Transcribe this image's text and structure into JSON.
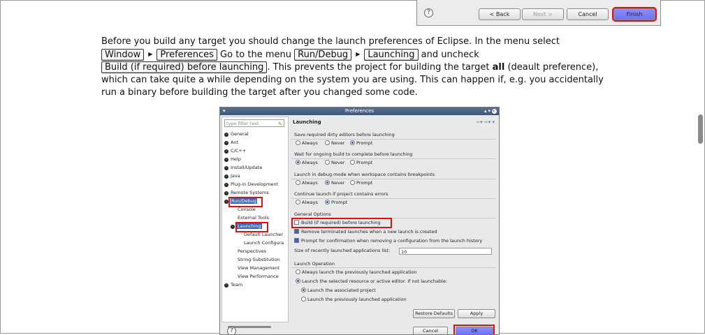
{
  "wizard": {
    "back": "< Back",
    "next": "Next >",
    "cancel": "Cancel",
    "finish": "Finish",
    "help_icon": "question-mark-icon"
  },
  "paragraph": {
    "t1": "Before you build any target you should change the launch preferences of Eclipse. In the menu select",
    "k_window": "Window",
    "k_preferences": "Preferences",
    "t2": "Go to the menu",
    "k_rundebug": "Run/Debug",
    "k_launching": "Launching",
    "t3": "and uncheck",
    "k_build": "Build (if required) before launching",
    "t4": ". This prevents the project for building the target",
    "bold_all": "all",
    "t5": "(deault preference), which can take quite a while depending on the system you are using. This can happen if, e.g. you accidentally run a binary before building the target after you changed some code."
  },
  "prefs": {
    "title": "Preferences",
    "filter_placeholder": "type filter text",
    "tree": [
      "General",
      "Ant",
      "C/C++",
      "Help",
      "Install/Update",
      "Java",
      "Plug-in Development",
      "Remote Systems",
      "Run/Debug",
      "Console",
      "External Tools",
      "Launching",
      "Default Launcher",
      "Launch Configura",
      "Perspectives",
      "String Substitution",
      "View Management",
      "View Performance",
      "Team"
    ],
    "heading": "Launching",
    "save_label": "Save required dirty editors before launching",
    "wait_label": "Wait for ongoing build to complete before launching",
    "debug_label": "Launch in debug mode when workspace contains breakpoints",
    "errors_label": "Continue launch if project contains errors",
    "opt_always": "Always",
    "opt_never": "Never",
    "opt_prompt": "Prompt",
    "general_options": "General Options",
    "chk_build": "Build (if required) before launching",
    "chk_remove": "Remove terminated launches when a new launch is created",
    "chk_prompt": "Prompt for confirmation when removing a configuration from the launch history",
    "size_label": "Size of recently launched applications list:",
    "size_value": "10",
    "launch_operation": "Launch Operation",
    "op_prev": "Always launch the previously launched application",
    "op_selected": "Launch the selected resource or active editor. If not launchable:",
    "op_assoc": "Launch the associated project",
    "op_prevapp": "Launch the previously launched application",
    "restore": "Restore Defaults",
    "apply": "Apply",
    "cancel": "Cancel",
    "ok": "OK"
  }
}
